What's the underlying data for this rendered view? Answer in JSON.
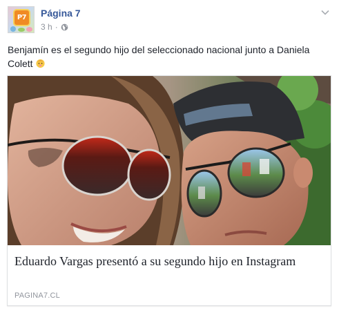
{
  "post": {
    "page_name": "Página 7",
    "time": "3 h",
    "separator": "·",
    "avatar_logo_text": "P7",
    "message": "Benjamín es el segundo hijo del seleccionado nacional junto a Daniela Colett",
    "emoji": "baby-emoji",
    "privacy_icon": "globe-icon",
    "menu_icon": "chevron-down-icon"
  },
  "link_card": {
    "title": "Eduardo Vargas presentó a su segundo hijo en Instagram",
    "domain": "PAGINA7.CL"
  },
  "colors": {
    "link_blue": "#365899",
    "meta_gray": "#90949c",
    "text": "#1d2129",
    "border": "#dddfe2"
  }
}
